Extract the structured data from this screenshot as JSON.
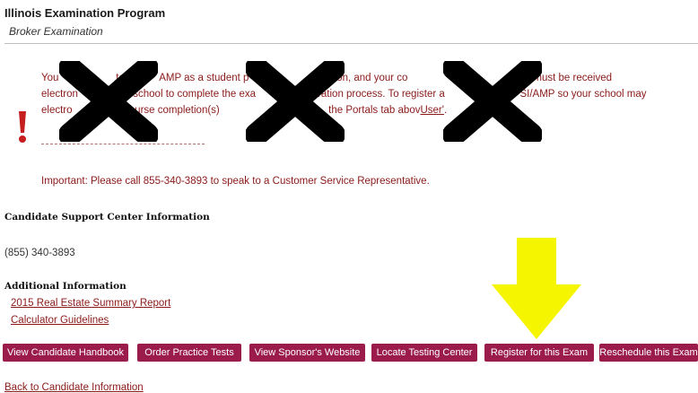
{
  "header": {
    "program_title": "Illinois Examination Program",
    "exam_name": "Broker Examination"
  },
  "notice": {
    "line1": "You                    ter           AMP as a student p                        pletion, and your co                    ent          ation must be received",
    "line2": "electron                 r school to complete the exa                  istration process. To register a                   ith PSI/AMP so your school may",
    "line3_text": "electro                  course completion(s)                                      the Portals tab abov",
    "line3_link": "User'",
    "line3_end": ".",
    "important": "Important: Please call 855-340-3893 to speak to a Customer Service Representative.",
    "alert_icon": "exclamation-icon",
    "text_color": "#8b1a1a"
  },
  "support": {
    "heading": "Candidate Support Center Information",
    "phone": "(855) 340-3893"
  },
  "additional": {
    "heading": "Additional Information",
    "links": [
      "2015 Real Estate Summary Report",
      "Calculator Guidelines"
    ]
  },
  "actions": {
    "buttons": [
      "View Candidate Handbook",
      "Order Practice Tests",
      "View Sponsor's Website",
      "Locate Testing Center",
      "Register for this Exam",
      "Reschedule this Exam"
    ],
    "button_color": "#9b1b4a"
  },
  "footer": {
    "back_link": "Back to Candidate Information"
  },
  "annotations": {
    "redaction_icon": "black-x-mark",
    "arrow_icon": "yellow-down-arrow",
    "arrow_color": "#f5f500"
  }
}
